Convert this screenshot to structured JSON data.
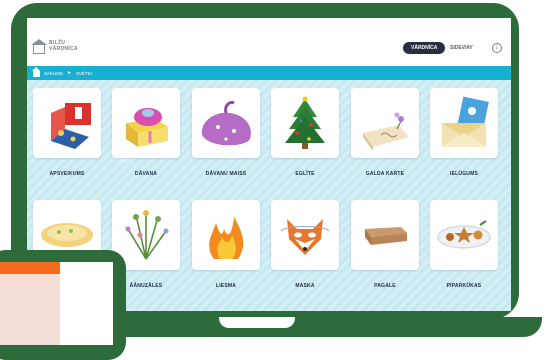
{
  "app": {
    "logo_line1": "BILŽU",
    "logo_line2": "VĀRDNĪCA"
  },
  "header": {
    "tab_dictionary": "VĀRDNĪCA",
    "tab_compose": "SIDEVIAY",
    "info_icon": "info-icon"
  },
  "breadcrumb": {
    "home_icon": "home-icon",
    "items": [
      "SĀKUMS",
      "SVĒTKI"
    ]
  },
  "colors": {
    "frame": "#2e6b3a",
    "accent": "#17b0d3",
    "active_tab": "#2a2d40",
    "label": "#1f2a44"
  },
  "cards": [
    {
      "label": "APSVEIKUMS",
      "icon": "greeting-card-icon"
    },
    {
      "label": "DĀVANA",
      "icon": "gift-box-icon"
    },
    {
      "label": "DĀVANU MAISS",
      "icon": "gift-sack-icon"
    },
    {
      "label": "EGLĪTE",
      "icon": "christmas-tree-icon"
    },
    {
      "label": "GALDA KARTE",
      "icon": "place-card-icon"
    },
    {
      "label": "IELŪGUMS",
      "icon": "invitation-envelope-icon"
    },
    {
      "label": "",
      "icon": "cake-icon"
    },
    {
      "label": "ĀĀNUZĀLES",
      "icon": "herb-bouquet-icon"
    },
    {
      "label": "LIESMA",
      "icon": "flame-icon"
    },
    {
      "label": "MASKA",
      "icon": "fox-mask-icon"
    },
    {
      "label": "PAGALE",
      "icon": "log-icon"
    },
    {
      "label": "PIPARKŪKAS",
      "icon": "gingerbread-plate-icon"
    }
  ]
}
